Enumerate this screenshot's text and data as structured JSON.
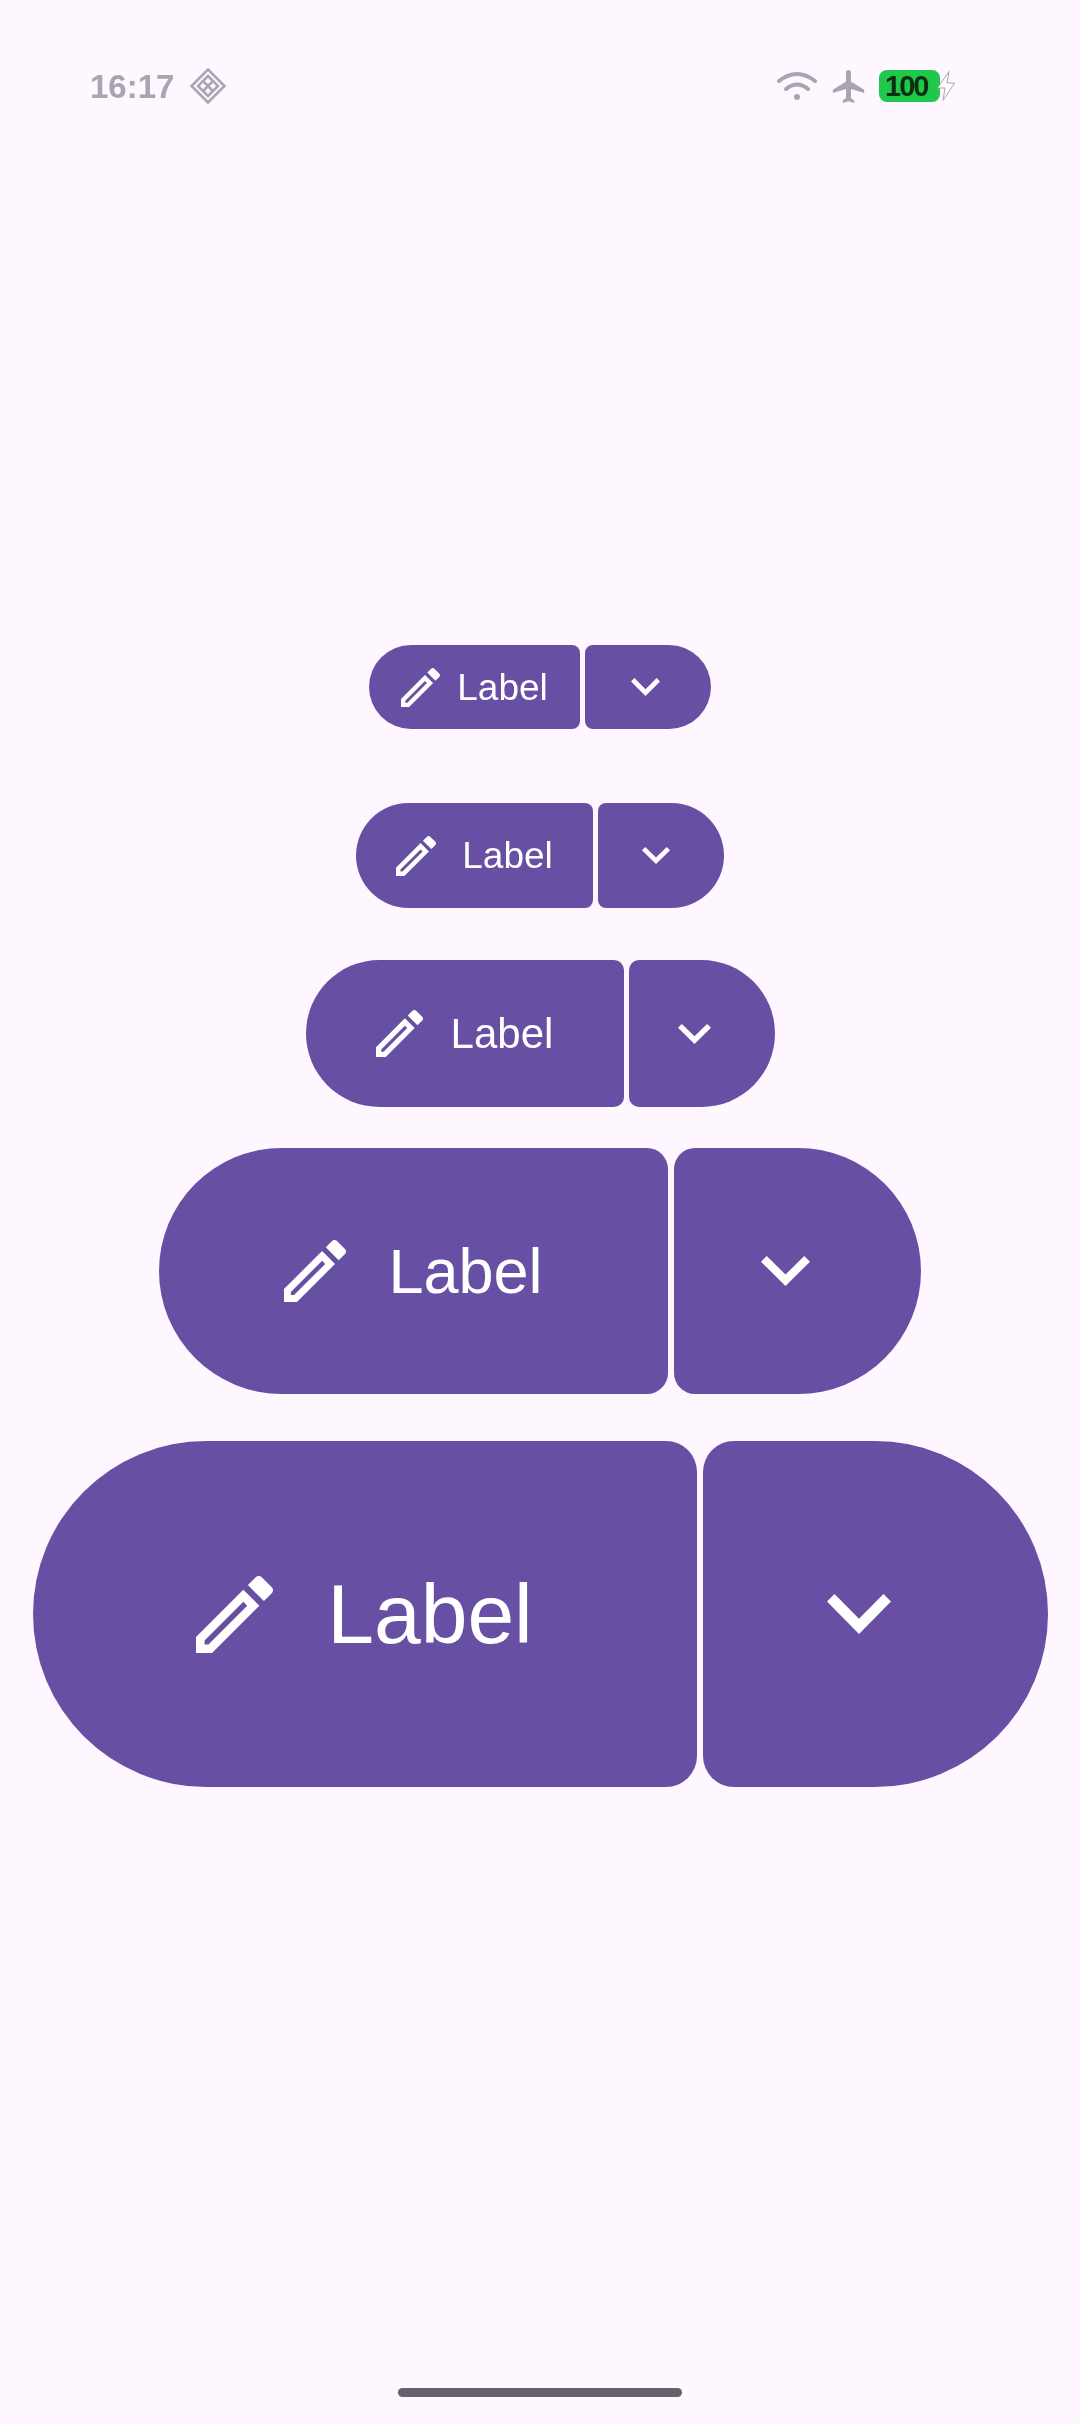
{
  "status_bar": {
    "time": "16:17",
    "battery": {
      "percent": "100",
      "charging": true
    }
  },
  "split_buttons": [
    {
      "kind": "xs",
      "label": "Label"
    },
    {
      "kind": "s",
      "label": "Label"
    },
    {
      "kind": "m",
      "label": "Label"
    },
    {
      "kind": "l",
      "label": "Label"
    },
    {
      "kind": "xl",
      "label": "Label"
    }
  ]
}
